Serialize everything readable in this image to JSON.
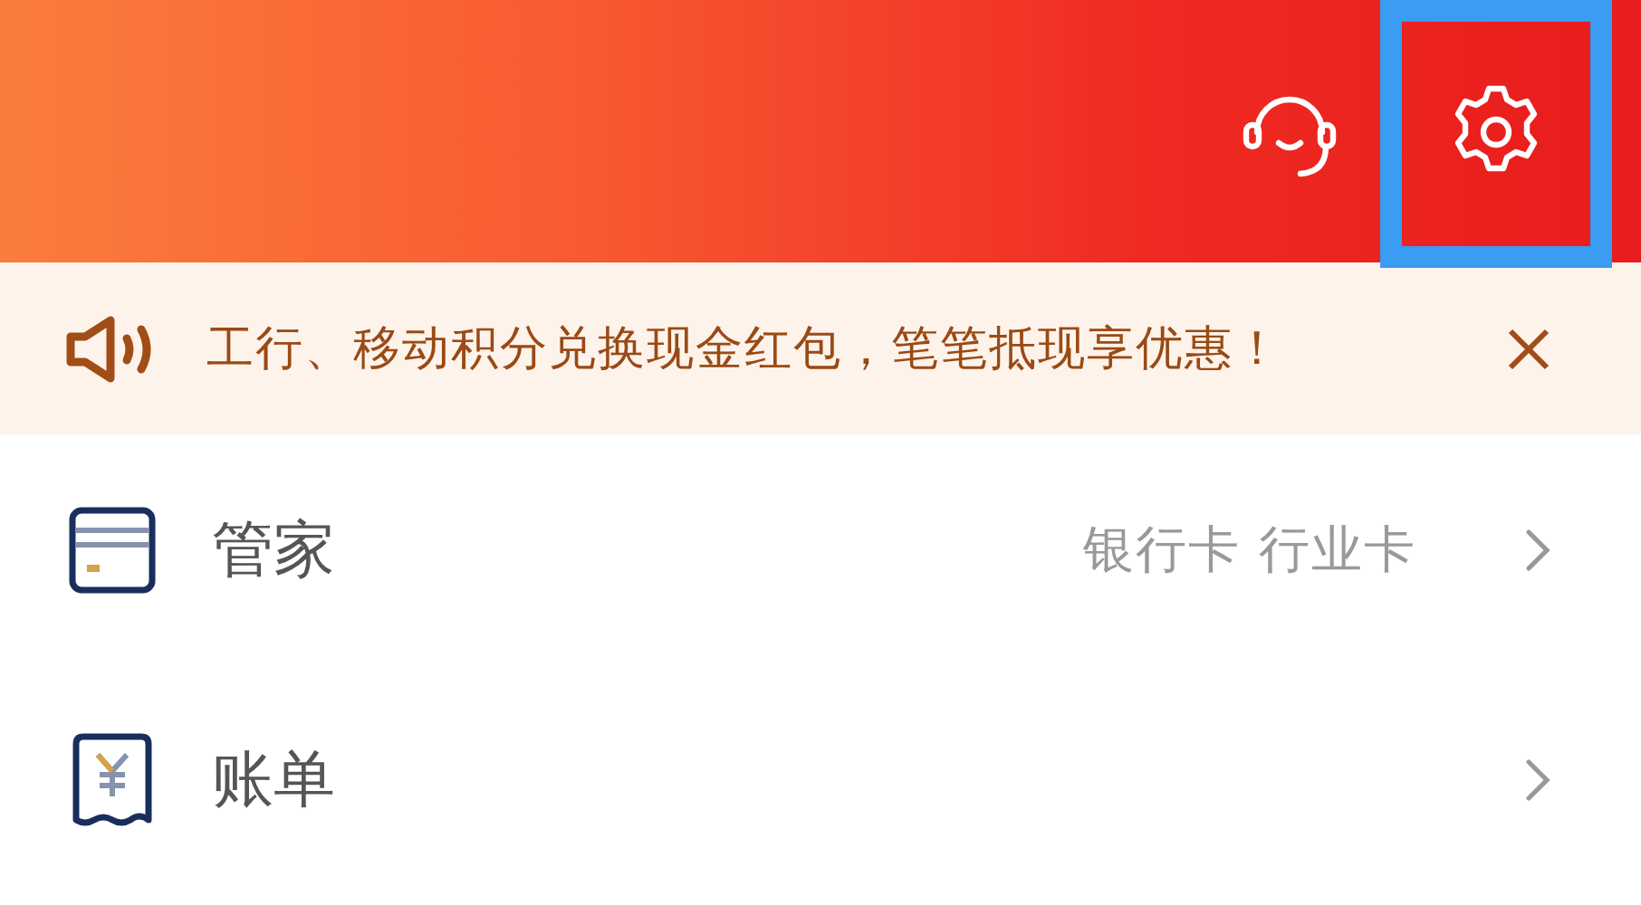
{
  "header": {
    "actions": [
      {
        "kind": "support",
        "highlighted": false
      },
      {
        "kind": "settings",
        "highlighted": true
      }
    ]
  },
  "notice": {
    "text": "工行、移动积分兑换现金红包，笔笔抵现享优惠！"
  },
  "rows": [
    {
      "kind": "card",
      "label": "管家",
      "detail": "银行卡 行业卡"
    },
    {
      "kind": "bill",
      "label": "账单"
    }
  ]
}
